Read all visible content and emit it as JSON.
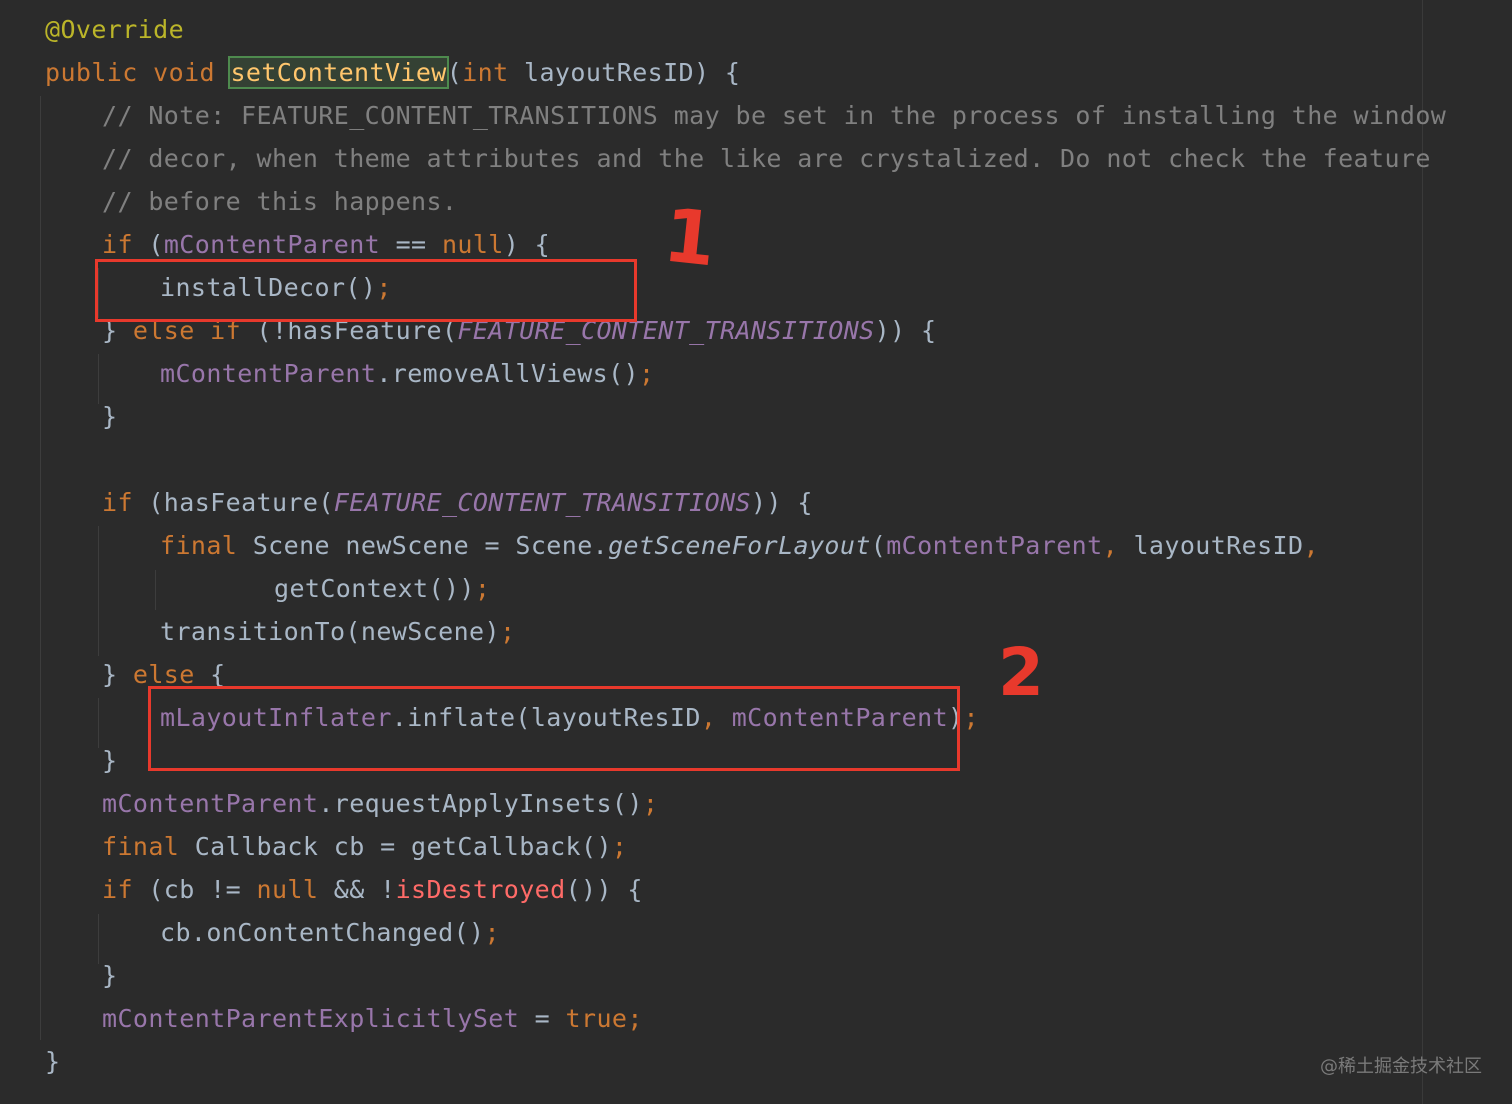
{
  "code": {
    "l1": {
      "annotation": "@Override"
    },
    "l2": {
      "kw1": "public",
      "kw2": "void",
      "method": "setContentView",
      "open": "(",
      "kw3": "int",
      "rest": " layoutResID) {"
    },
    "l3": {
      "comment": "// Note: FEATURE_CONTENT_TRANSITIONS may be set in the process of installing the window"
    },
    "l4": {
      "comment": "// decor, when theme attributes and the like are crystalized. Do not check the feature"
    },
    "l5": {
      "comment": "// before this happens."
    },
    "l6": {
      "kw": "if",
      "a": " (",
      "field": "mContentParent",
      "b": " == ",
      "kw2": "null",
      "c": ") {"
    },
    "l7": {
      "text": "installDecor()",
      "semi": ";"
    },
    "l8": {
      "a": "} ",
      "kw1": "else",
      "sp": " ",
      "kw2": "if",
      "b": " (!hasFeature(",
      "const": "FEATURE_CONTENT_TRANSITIONS",
      "c": ")) {"
    },
    "l9": {
      "field": "mContentParent",
      "text": ".removeAllViews()",
      "semi": ";"
    },
    "l10": {
      "text": "}"
    },
    "l11": {
      "kw": "if",
      "a": " (hasFeature(",
      "const": "FEATURE_CONTENT_TRANSITIONS",
      "b": ")) {"
    },
    "l12": {
      "kw": "final",
      "a": " Scene newScene = Scene.",
      "static": "getSceneForLayout",
      "b": "(",
      "field": "mContentParent",
      "comma": ",",
      "c": " layoutResID",
      "comma2": ","
    },
    "l13": {
      "text": "getContext())",
      "semi": ";"
    },
    "l14": {
      "text": "transitionTo(newScene)",
      "semi": ";"
    },
    "l15": {
      "a": "} ",
      "kw": "else",
      "b": " {"
    },
    "l16": {
      "field1": "mLayoutInflater",
      "a": ".inflate(layoutResID",
      "comma": ",",
      "sp": " ",
      "field2": "mContentParent",
      "b": ")",
      "semi": ";"
    },
    "l17": {
      "text": "}"
    },
    "l18": {
      "field": "mContentParent",
      "text": ".requestApplyInsets()",
      "semi": ";"
    },
    "l19": {
      "kw": "final",
      "text": " Callback cb = getCallback()",
      "semi": ";"
    },
    "l20": {
      "kw": "if",
      "a": " (cb != ",
      "kw2": "null",
      "b": " && !",
      "dep": "isDestroyed",
      "c": "()) {"
    },
    "l21": {
      "text": "cb.onContentChanged()",
      "semi": ";"
    },
    "l22": {
      "text": "}"
    },
    "l23": {
      "field": "mContentParentExplicitlySet",
      "a": " = ",
      "kw": "true",
      "semi": ";"
    },
    "l24": {
      "text": "}"
    }
  },
  "annotations": {
    "mark1": "1",
    "mark2": "2"
  },
  "watermark": "@稀土掘金技术社区",
  "colors": {
    "background": "#2b2b2b",
    "keyword": "#cc7832",
    "annotation": "#bbb529",
    "comment": "#808080",
    "field": "#9876aa",
    "method_highlight": "#ffc66d",
    "red_markup": "#e8392c"
  }
}
